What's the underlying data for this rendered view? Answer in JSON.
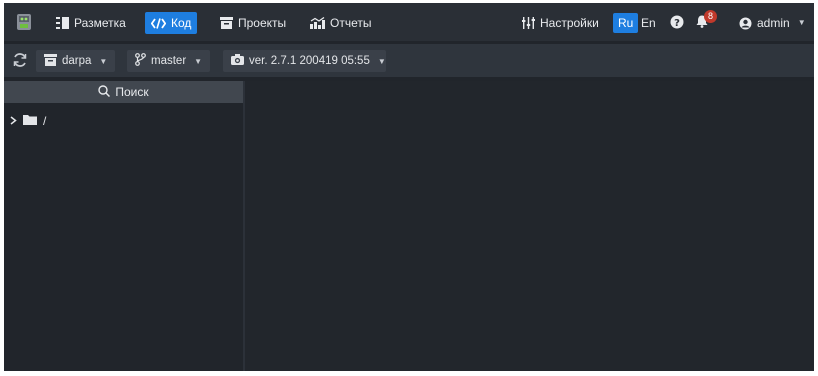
{
  "nav": {
    "items": [
      {
        "label": "Разметка",
        "icon": "markup-icon"
      },
      {
        "label": "Код",
        "icon": "code-icon",
        "active": true
      },
      {
        "label": "Проекты",
        "icon": "projects-icon"
      },
      {
        "label": "Отчеты",
        "icon": "reports-icon"
      }
    ],
    "settings_label": "Настройки",
    "languages": [
      {
        "label": "Ru",
        "active": true
      },
      {
        "label": "En",
        "active": false
      }
    ],
    "notifications_count": "8",
    "user": "admin"
  },
  "toolbar": {
    "repo": "darpa",
    "branch": "master",
    "version": "ver. 2.7.1 200419 05:55"
  },
  "sidebar": {
    "search_label": "Поиск",
    "tree": [
      {
        "label": "/"
      }
    ]
  },
  "colors": {
    "accent": "#1e7ee0",
    "background": "#21252b",
    "topbar": "#2a2f36",
    "badge": "#c0392b"
  }
}
